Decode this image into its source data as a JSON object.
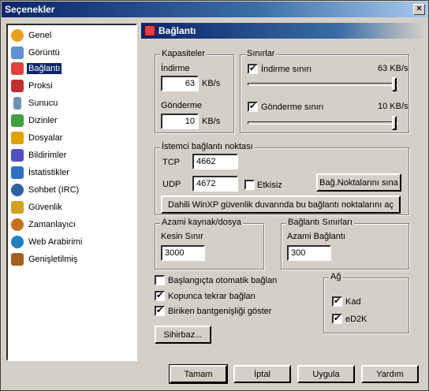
{
  "window": {
    "title": "Seçenekler",
    "close_label": "×"
  },
  "sidebar": {
    "items": [
      {
        "label": "Genel",
        "icon": "gear-icon",
        "color": "#e8a020"
      },
      {
        "label": "Görüntü",
        "icon": "display-icon",
        "color": "#6090d0"
      },
      {
        "label": "Bağlantı",
        "icon": "plug-icon",
        "color": "#e04040"
      },
      {
        "label": "Proksi",
        "icon": "proxy-icon",
        "color": "#c03030"
      },
      {
        "label": "Sunucu",
        "icon": "server-icon",
        "color": "#7090b0"
      },
      {
        "label": "Dizinler",
        "icon": "folder-icon",
        "color": "#40a040"
      },
      {
        "label": "Dosyalar",
        "icon": "files-icon",
        "color": "#e0a000"
      },
      {
        "label": "Bildirimler",
        "icon": "notification-icon",
        "color": "#5050c0"
      },
      {
        "label": "İstatistikler",
        "icon": "stats-icon",
        "color": "#3070c0"
      },
      {
        "label": "Sohbet (IRC)",
        "icon": "chat-icon",
        "color": "#3060a0"
      },
      {
        "label": "Güvenlik",
        "icon": "lock-icon",
        "color": "#d0a020"
      },
      {
        "label": "Zamanlayıcı",
        "icon": "clock-icon",
        "color": "#c07020"
      },
      {
        "label": "Web Arabirimi",
        "icon": "globe-icon",
        "color": "#2080c0"
      },
      {
        "label": "Genişletilmiş",
        "icon": "puzzle-icon",
        "color": "#a06020"
      }
    ],
    "selected_index": 2
  },
  "panel": {
    "title": "Bağlantı"
  },
  "capacities": {
    "title": "Kapasiteler",
    "download_label": "İndirme",
    "download_value": "63",
    "download_unit": "KB/s",
    "upload_label": "Gönderme",
    "upload_value": "10",
    "upload_unit": "KB/s"
  },
  "limits": {
    "title": "Sınırlar",
    "download_limit_label": "İndirme sınırı",
    "download_limit_value": "63 KB/s",
    "download_limit_checked": "✔",
    "upload_limit_label": "Gönderme sınırı",
    "upload_limit_value": "10 KB/s",
    "upload_limit_checked": "✔"
  },
  "client_port": {
    "title": "İstemci bağlantı noktası",
    "tcp_label": "TCP",
    "tcp_value": "4662",
    "udp_label": "UDP",
    "udp_value": "4672",
    "disabled_label": "Etkisiz",
    "test_ports_button": "Bağ.Noktalarını sına",
    "winxp_button": "Dahili WinXP güvenlik duvarında bu bağlantı noktalarını aç"
  },
  "max_sources": {
    "title": "Azami kaynak/dosya",
    "hard_limit_label": "Kesin Sınır",
    "hard_limit_value": "3000"
  },
  "connection_limits": {
    "title": "Bağlantı Sınırları",
    "max_connections_label": "Azami Bağlantı",
    "max_connections_value": "300"
  },
  "options": {
    "autoconnect_label": "Başlangıçta otomatik bağlan",
    "reconnect_label": "Kopunca tekrar bağlan",
    "reconnect_checked": "✔",
    "overhead_label": "Biriken bantgenişliği göster",
    "overhead_checked": "✔"
  },
  "network": {
    "title": "Ağ",
    "kad_label": "Kad",
    "kad_checked": "✔",
    "ed2k_label": "eD2K",
    "ed2k_checked": "✔"
  },
  "wizard_button": "Sihirbaz...",
  "footer": {
    "ok": "Tamam",
    "cancel": "İptal",
    "apply": "Uygula",
    "help": "Yardım"
  }
}
